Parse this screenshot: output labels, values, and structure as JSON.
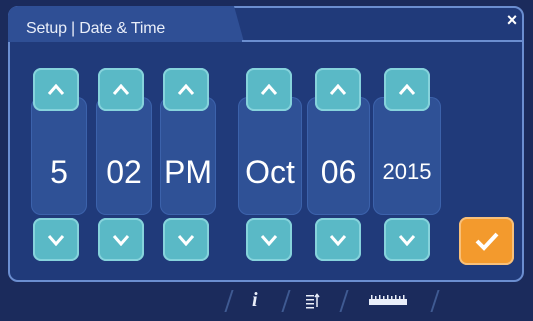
{
  "header": {
    "title": "Setup | Date & Time",
    "close_glyph": "×"
  },
  "time": {
    "hour": "5",
    "minute": "02",
    "ampm": "PM"
  },
  "date": {
    "month": "Oct",
    "day": "06",
    "year": "2015"
  },
  "footer": {
    "info_glyph": "i"
  },
  "colors": {
    "background": "#1b2b5c",
    "panel": "#203a7a",
    "column": "#2f5196",
    "arrow_button": "#5ab9c6",
    "confirm_button": "#f39a2d"
  },
  "icons": {
    "up": "chevron-up-icon",
    "down": "chevron-down-icon",
    "confirm": "check-icon",
    "close": "close-icon",
    "info": "info-icon",
    "sort": "sort-icon",
    "ruler": "ruler-icon"
  }
}
